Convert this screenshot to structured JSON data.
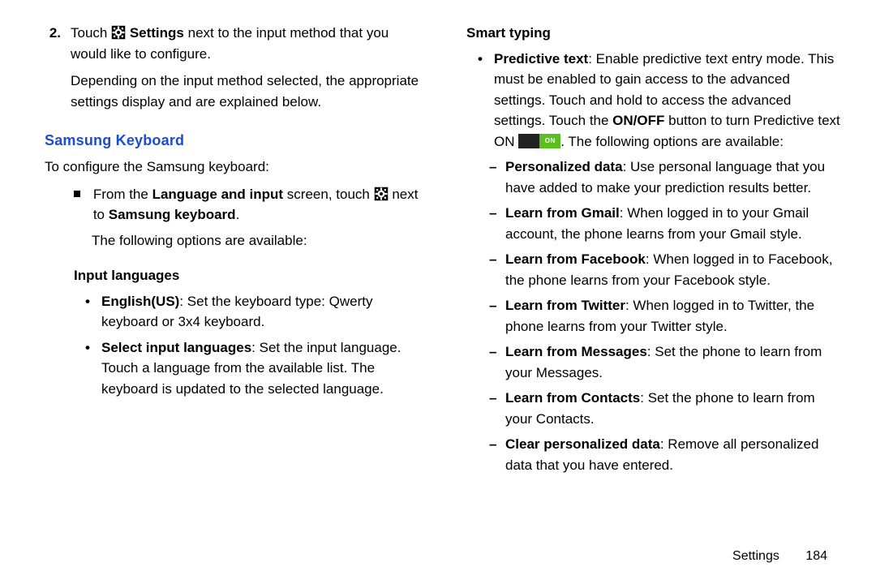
{
  "left": {
    "step_num": "2.",
    "step_line1a": "Touch ",
    "step_line1b": " Settings",
    "step_line1c": " next to the input method that you would like to configure.",
    "step_para2": "Depending on the input method selected, the appropriate settings display and are explained below.",
    "section_title": "Samsung Keyboard",
    "intro": "To configure the Samsung keyboard:",
    "sq_a": "From the ",
    "sq_b": "Language and input",
    "sq_c": " screen, touch ",
    "sq_d": " next to ",
    "sq_e": "Samsung keyboard",
    "sq_f": ".",
    "follow": "The following options are available:",
    "input_lang_title": "Input languages",
    "il1_b": "English(US)",
    "il1_t": ": Set the keyboard type: Qwerty keyboard or 3x4 keyboard.",
    "il2_b": "Select input languages",
    "il2_t": ": Set the input language. Touch a language from the available list. The keyboard is updated to the selected language."
  },
  "right": {
    "smart_title": "Smart typing",
    "pt_b": "Predictive text",
    "pt_t1": ": Enable predictive text entry mode. This must be enabled to gain access to the advanced settings. Touch and hold to access the advanced settings. Touch the ",
    "pt_onoff": "ON/OFF",
    "pt_t2": " button to turn Predictive text ON ",
    "pt_t3": ". The following options are available:",
    "on_label": "ON",
    "d1_b": "Personalized data",
    "d1_t": ": Use personal language that you have added to make your prediction results better.",
    "d2_b": "Learn from Gmail",
    "d2_t": ": When logged in to your Gmail account, the phone learns from your Gmail style.",
    "d3_b": "Learn from Facebook",
    "d3_t": ": When logged in to Facebook, the phone learns from your Facebook style.",
    "d4_b": "Learn from Twitter",
    "d4_t": ": When logged in to Twitter, the phone learns from your Twitter style.",
    "d5_b": "Learn from Messages",
    "d5_t": ": Set the phone to learn from your Messages.",
    "d6_b": "Learn from Contacts",
    "d6_t": ": Set the phone to learn from your Contacts.",
    "d7_b": "Clear personalized data",
    "d7_t": ": Remove all personalized data that you have entered."
  },
  "footer": {
    "section": "Settings",
    "page": "184"
  }
}
